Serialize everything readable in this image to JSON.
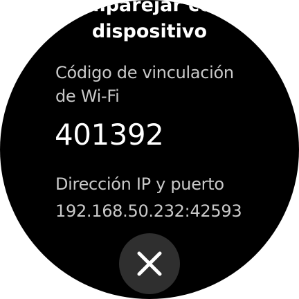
{
  "title": {
    "line1": "Emparejar con",
    "line2": "dispositivo"
  },
  "pairing": {
    "code_label_line1": "Código de vinculación",
    "code_label_line2": "de Wi-Fi",
    "code_value": "401392",
    "ip_label": "Dirección IP y puerto",
    "ip_value": "192.168.50.232:42593"
  },
  "actions": {
    "close_icon": "close-icon"
  },
  "colors": {
    "background": "#000000",
    "primary_text": "#ffffff",
    "secondary_text": "#c9c9c9",
    "button_bg": "#2f2f2f"
  }
}
